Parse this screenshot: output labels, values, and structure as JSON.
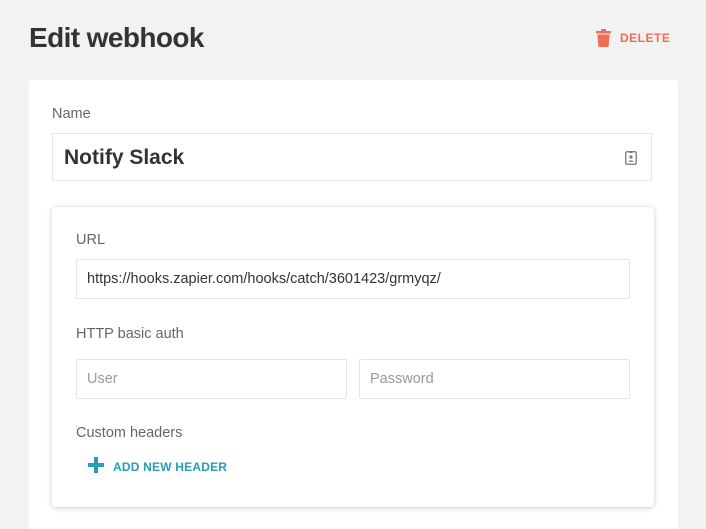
{
  "header": {
    "title": "Edit webhook",
    "delete_label": "DELETE"
  },
  "form": {
    "name_label": "Name",
    "name_value": "Notify Slack",
    "url_label": "URL",
    "url_value": "https://hooks.zapier.com/hooks/catch/3601423/grmyqz/",
    "auth_label": "HTTP basic auth",
    "user_placeholder": "User",
    "password_placeholder": "Password",
    "custom_headers_label": "Custom headers",
    "add_header_label": "ADD NEW HEADER"
  },
  "icons": {
    "delete": "trash-icon",
    "name_field": "contact-card-icon",
    "add_header": "plus-icon"
  },
  "colors": {
    "delete_accent": "#f06e55",
    "add_accent": "#2a9db0",
    "background": "#f2f2f2"
  }
}
